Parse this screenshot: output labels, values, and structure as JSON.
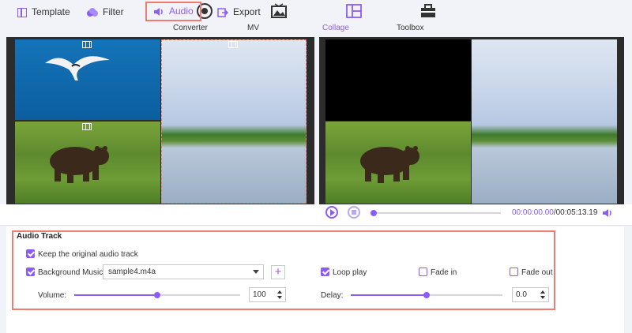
{
  "nav": {
    "items": [
      {
        "label": "Converter",
        "icon": "converter-icon"
      },
      {
        "label": "MV",
        "icon": "mv-icon"
      },
      {
        "label": "Collage",
        "icon": "collage-icon",
        "active": true
      },
      {
        "label": "Toolbox",
        "icon": "toolbox-icon"
      }
    ]
  },
  "tabs": {
    "template": "Template",
    "filter": "Filter",
    "audio": "Audio",
    "export": "Export"
  },
  "player": {
    "current_time": "00:00:00.00",
    "total_time": "/00:05:13.19",
    "progress": 0
  },
  "audio_panel": {
    "title": "Audio Track",
    "keep_original_label": "Keep the original audio track",
    "keep_original_checked": true,
    "background_music_label": "Background Music",
    "background_music_checked": true,
    "music_file": "sample4.m4a",
    "loop_label": "Loop play",
    "loop_checked": true,
    "fade_in_label": "Fade in",
    "fade_in_checked": false,
    "fade_out_label": "Fade out",
    "fade_out_checked": false,
    "volume_label": "Volume:",
    "volume_value": "100",
    "volume_fraction": 0.5,
    "delay_label": "Delay:",
    "delay_value": "0.0",
    "delay_fraction": 0.5
  },
  "colors": {
    "accent": "#8b5cf6",
    "highlight": "#ee7d6f"
  }
}
